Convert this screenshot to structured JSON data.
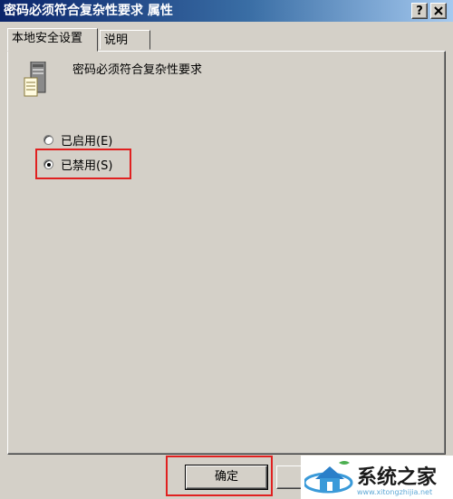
{
  "window": {
    "title": "密码必须符合复杂性要求 属性"
  },
  "titlebar_buttons": {
    "help": "?",
    "close": "X"
  },
  "tabs": [
    {
      "label": "本地安全设置",
      "active": true
    },
    {
      "label": "说明",
      "active": false
    }
  ],
  "policy": {
    "name": "密码必须符合复杂性要求",
    "icon": "server-policy-icon"
  },
  "options": [
    {
      "label": "已启用(E)",
      "selected": false
    },
    {
      "label": "已禁用(S)",
      "selected": true
    }
  ],
  "buttons": {
    "ok": "确定"
  },
  "watermark": {
    "text": "系统之家",
    "url": "www.xitongzhijia.net"
  },
  "highlight_color": "#e02020"
}
